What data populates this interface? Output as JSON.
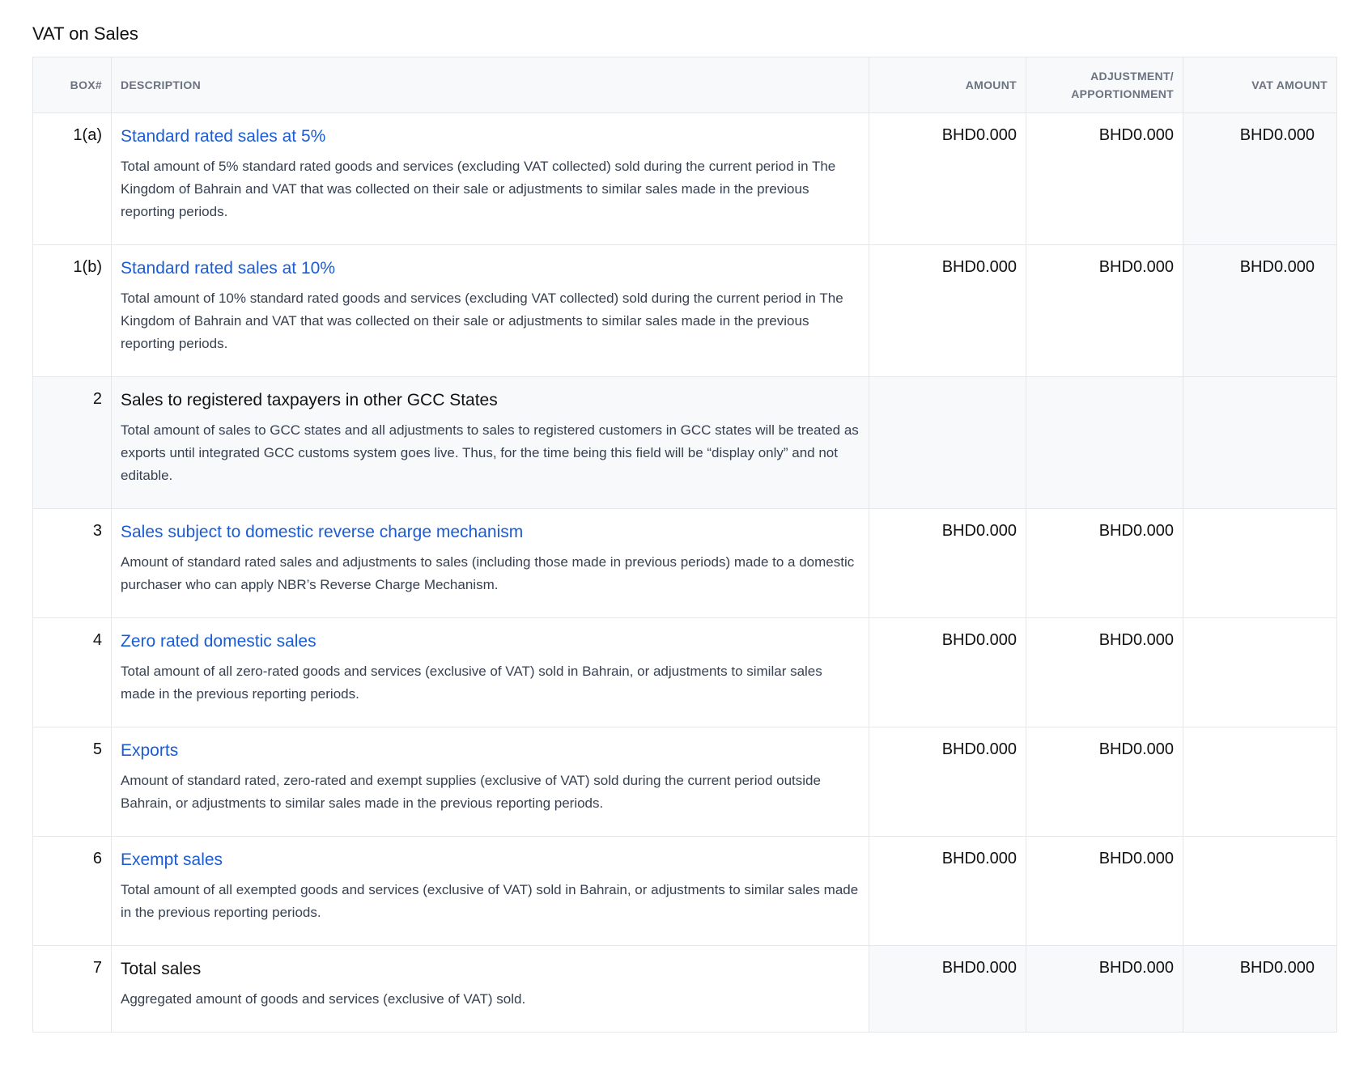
{
  "section": {
    "title": "VAT on Sales"
  },
  "table": {
    "headers": {
      "box": "BOX#",
      "description": "DESCRIPTION",
      "amount": "AMOUNT",
      "adjustment_line1": "ADJUSTMENT/",
      "adjustment_line2": "APPORTIONMENT",
      "vat_amount": "VAT AMOUNT"
    },
    "rows": [
      {
        "box": "1(a)",
        "title": "Standard rated sales at 5%",
        "description": "Total amount of 5% standard rated goods and services (excluding VAT collected) sold during the current period in The Kingdom of Bahrain and VAT that was collected on their sale or adjustments to similar sales made in the previous reporting periods.",
        "amount": "BHD0.000",
        "adjustment": "BHD0.000",
        "vat_amount": "BHD0.000"
      },
      {
        "box": "1(b)",
        "title": "Standard rated sales at 10%",
        "description": "Total amount of 10% standard rated goods and services (excluding VAT collected) sold during the current period in The Kingdom of Bahrain and VAT that was collected on their sale or adjustments to similar sales made in the previous reporting periods.",
        "amount": "BHD0.000",
        "adjustment": "BHD0.000",
        "vat_amount": "BHD0.000"
      },
      {
        "box": "2",
        "title": "Sales to registered taxpayers in other GCC States",
        "description": "Total amount of sales to GCC states and all adjustments to sales to registered customers in GCC states will be treated as exports until integrated GCC customs system goes live. Thus, for the time being this field will be “display only” and not editable."
      },
      {
        "box": "3",
        "title": "Sales subject to domestic reverse charge mechanism",
        "description": "Amount of standard rated sales and adjustments to sales (including those made in previous periods) made to a domestic purchaser who can apply NBR’s Reverse Charge Mechanism.",
        "amount": "BHD0.000",
        "adjustment": "BHD0.000"
      },
      {
        "box": "4",
        "title": "Zero rated domestic sales",
        "description": "Total amount of all zero-rated goods and services (exclusive of VAT) sold in Bahrain, or adjustments to similar sales made in the previous reporting periods.",
        "amount": "BHD0.000",
        "adjustment": "BHD0.000"
      },
      {
        "box": "5",
        "title": "Exports",
        "description": "Amount of standard rated, zero-rated and exempt supplies (exclusive of VAT) sold during the current period outside Bahrain, or adjustments to similar sales made in the previous reporting periods.",
        "amount": "BHD0.000",
        "adjustment": "BHD0.000"
      },
      {
        "box": "6",
        "title": "Exempt sales",
        "description": "Total amount of all exempted goods and services (exclusive of VAT) sold in Bahrain, or adjustments to similar sales made in the previous reporting periods.",
        "amount": "BHD0.000",
        "adjustment": "BHD0.000"
      },
      {
        "box": "7",
        "title": "Total sales",
        "description": "Aggregated amount of goods and services (exclusive of VAT) sold.",
        "amount": "BHD0.000",
        "adjustment": "BHD0.000",
        "vat_amount": "BHD0.000"
      }
    ]
  },
  "colors": {
    "link": "#1a5cd6",
    "header_bg": "#f8f9fb",
    "border": "#e5e7eb"
  }
}
